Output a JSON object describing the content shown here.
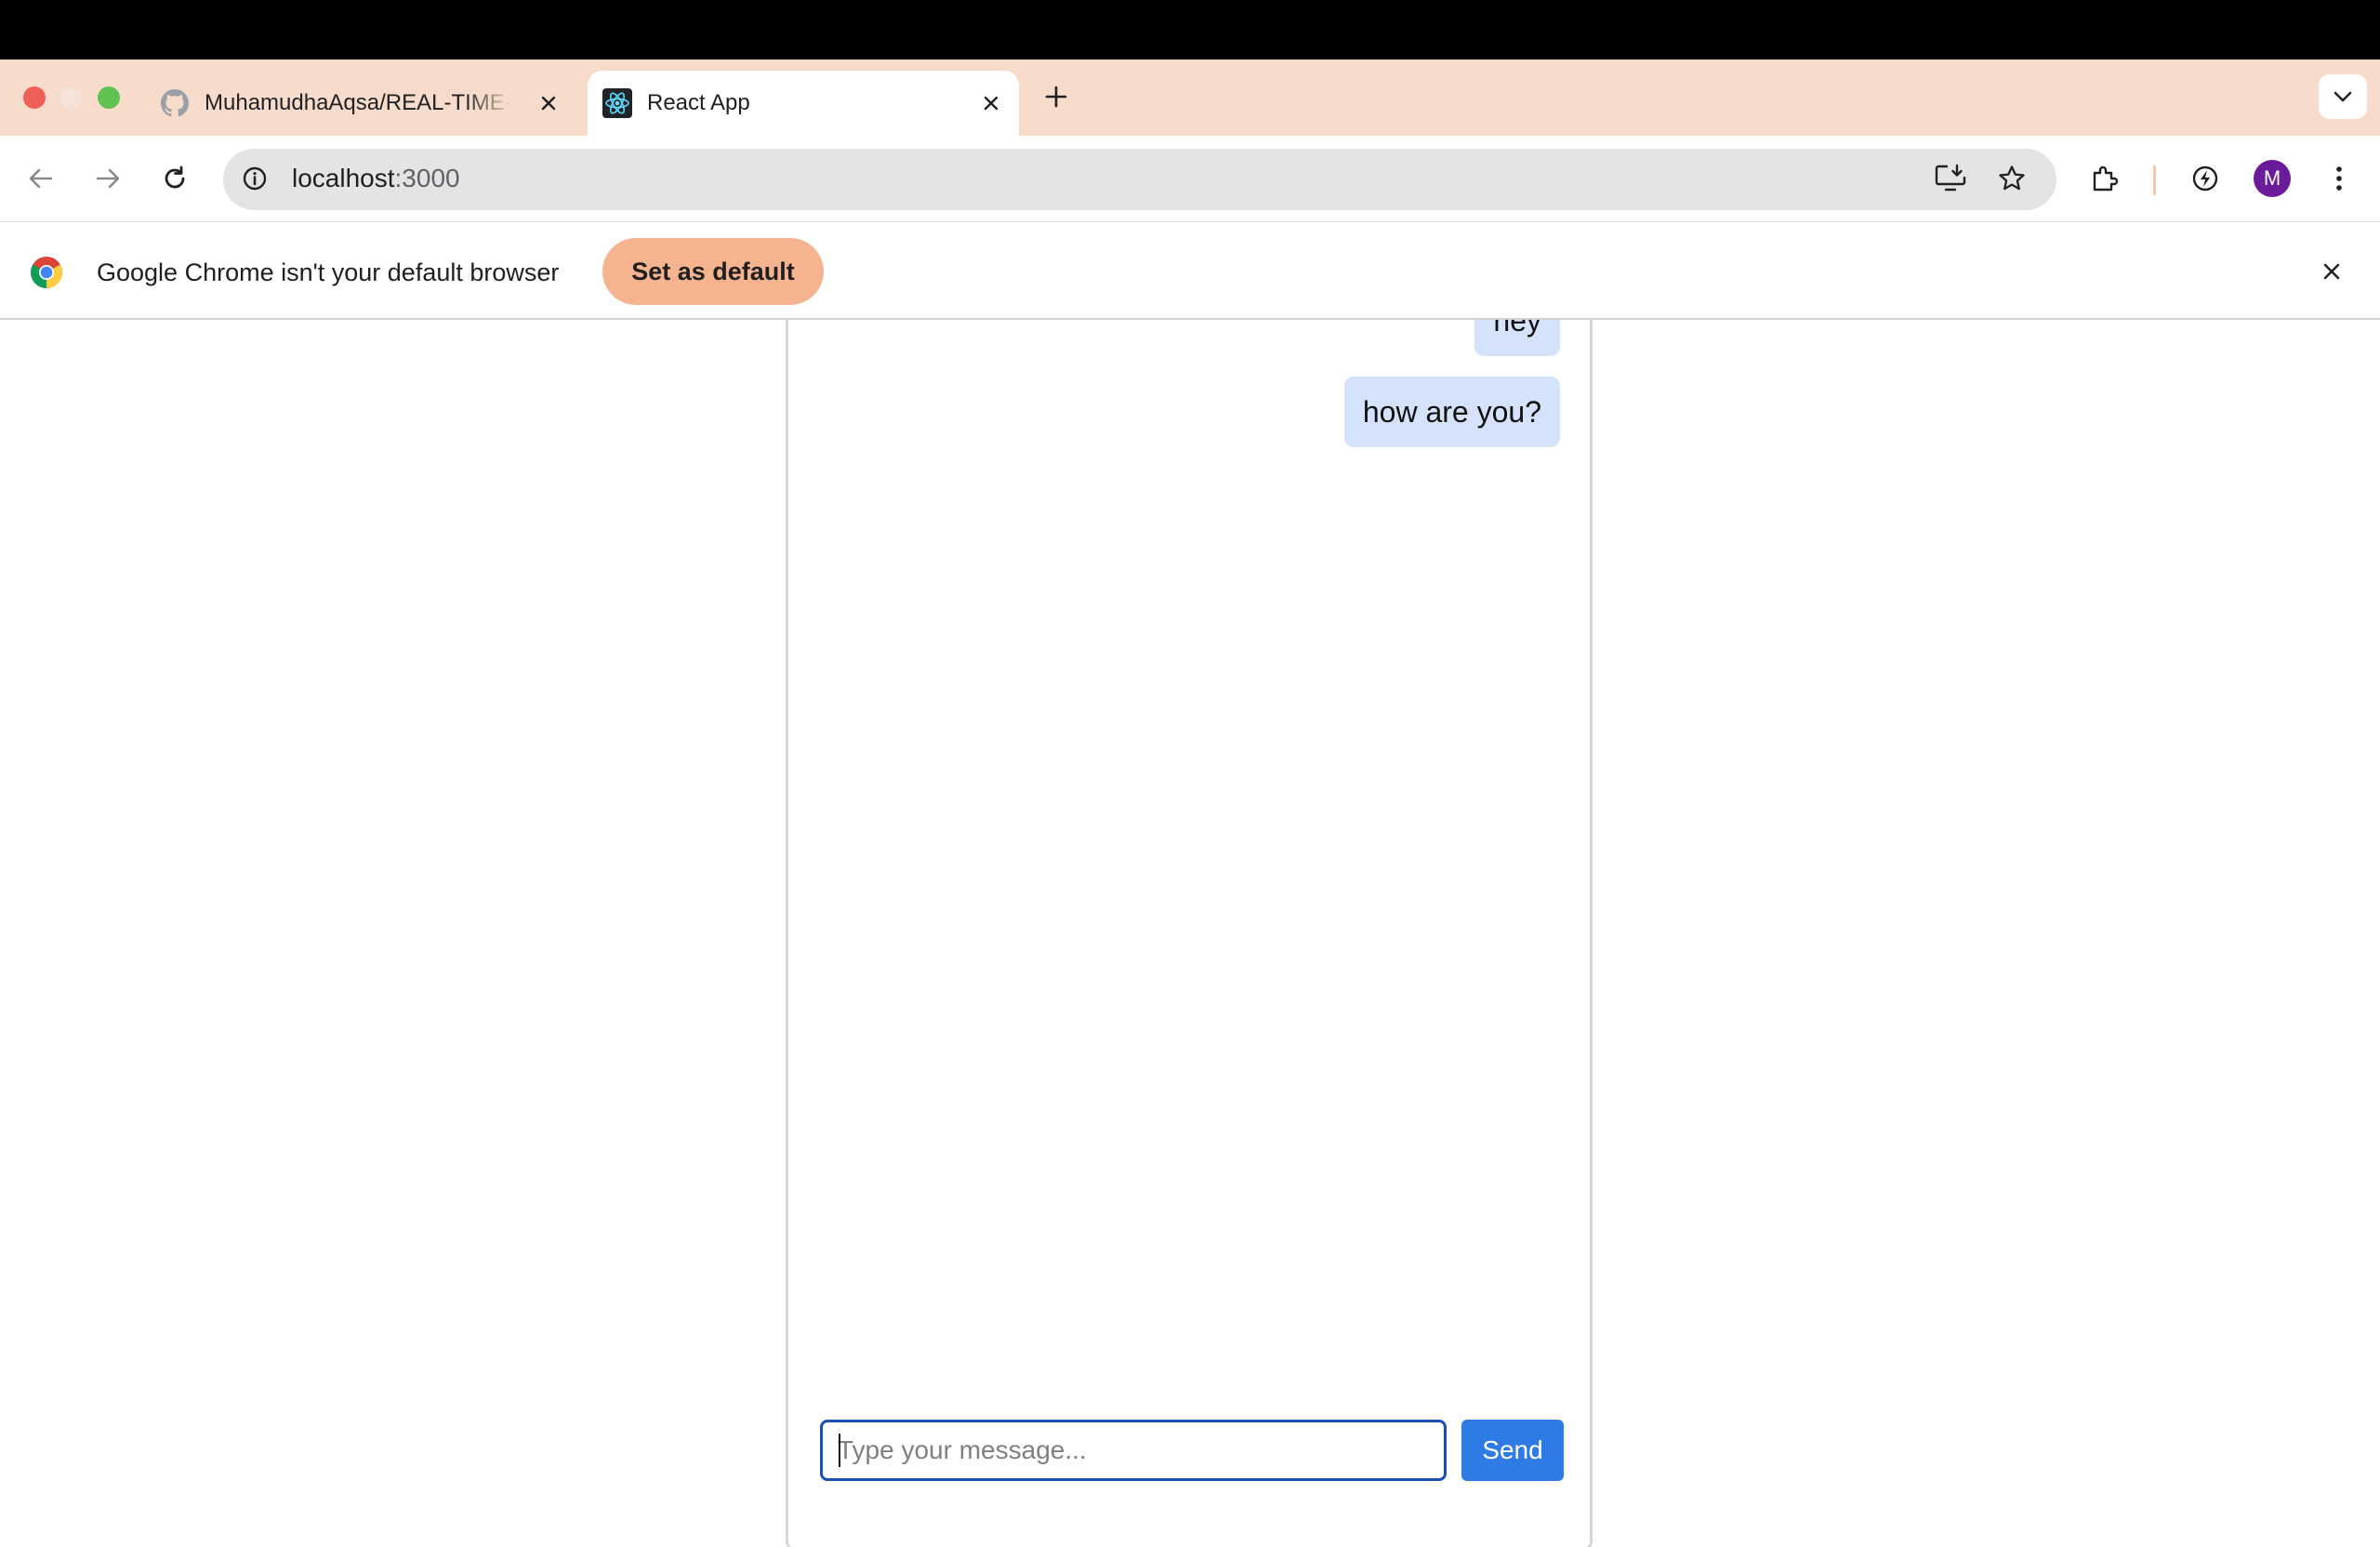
{
  "browser": {
    "tabs": [
      {
        "title": "MuhamudhaAqsa/REAL-TIME-CHAT-APPLICATION",
        "icon": "github-icon",
        "active": false
      },
      {
        "title": "React App",
        "icon": "react-icon",
        "active": true
      }
    ],
    "address": {
      "host": "localhost",
      "port": ":3000"
    },
    "avatar_initial": "M",
    "accent_color": "#f7dccb"
  },
  "infobar": {
    "message": "Google Chrome isn't your default browser",
    "button_label": "Set as default"
  },
  "chat": {
    "messages": [
      {
        "text": "hey",
        "side": "right"
      },
      {
        "text": "how are you?",
        "side": "right"
      }
    ],
    "input": {
      "placeholder": "Type your message...",
      "value": ""
    },
    "send_label": "Send",
    "bubble_color": "#d4e3fb",
    "button_color": "#2f7be5"
  }
}
